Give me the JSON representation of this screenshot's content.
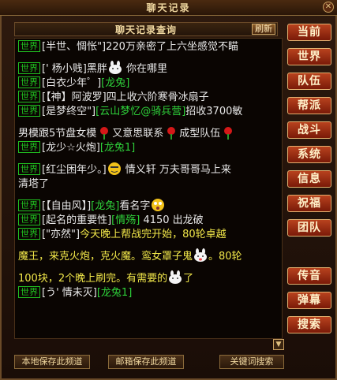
{
  "window": {
    "title": "聊天记录",
    "close_icon": "close-icon"
  },
  "subtitle": {
    "title": "聊天记录查询",
    "refresh_label": "刷新"
  },
  "tag_world": "世界",
  "messages": [
    {
      "name": "[半世、惆怅\"]",
      "text": "220万亲密了上六坐感觉不瞄",
      "style": "normal"
    },
    {
      "name": "[' 杨小贱]",
      "text": "黑胖",
      "after": "你在哪里",
      "emoji": "bunny-emoji"
    },
    {
      "name": "[白衣少年゜]",
      "green": "[龙兔]"
    },
    {
      "name": "[【神】阿波罗]",
      "text": "四上收六阶寒骨冰扇子"
    },
    {
      "name": "[是梦终空\"]",
      "green": "[云山梦忆@骑兵营]",
      "text": "招收3700敏"
    },
    {
      "text_line": "男模跟5节盘女模",
      "text_mid": "又意思联系",
      "text_end": "成型队伍"
    },
    {
      "name": "[龙少☆火炮]",
      "green": "[龙兔1]"
    },
    {
      "name": "[红尘困年少。]",
      "text": "情义轩 万夫哥哥马上来",
      "cont": "清塔了"
    },
    {
      "name": "[【自由风】]",
      "green": "[龙兔]",
      "text": "看名字"
    },
    {
      "name": "[起名的重要性]",
      "green": "[情殇]",
      "text": "4150 出龙破"
    },
    {
      "name": "[\"亦然\"]",
      "yellow": "今天晚上帮战完开始，80轮卓越"
    },
    {
      "yellow_line": "魔王，来克火炮，克火魔。鸾女罩子鬼",
      "yellow_end": "。80轮"
    },
    {
      "yellow_line2": "100块，2个晚上刷完。有需要的",
      "yellow_end2": "了"
    },
    {
      "name": "[う' 情未灭]",
      "green": "[龙兔1]"
    }
  ],
  "right_buttons": [
    "当前",
    "世界",
    "队伍",
    "帮派",
    "战斗",
    "系统",
    "信息",
    "祝福",
    "团队",
    "传音",
    "弹幕",
    "搜索"
  ],
  "bottom_buttons": [
    "本地保存此频道",
    "邮箱保存此频道",
    "关键词搜索"
  ]
}
